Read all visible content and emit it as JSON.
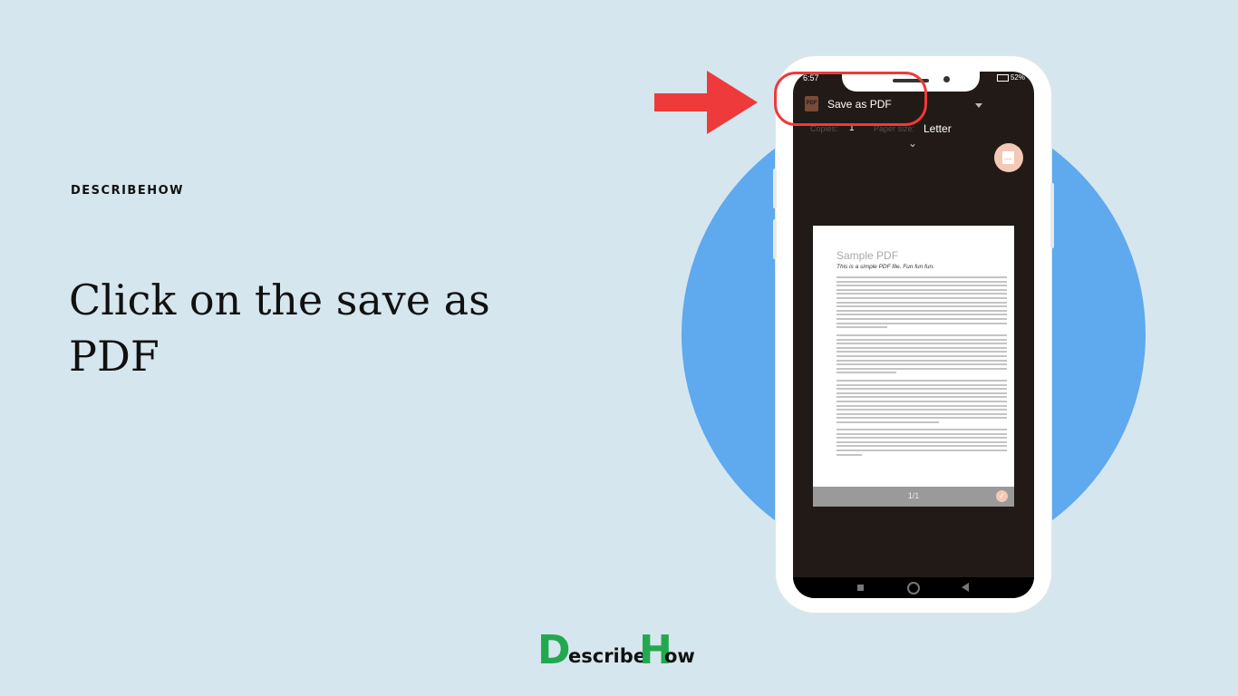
{
  "brand": {
    "label": "DESCRIBEHOW",
    "logo_first": "D",
    "logo_middle": "escribe",
    "logo_h": "H",
    "logo_end": "ow"
  },
  "headline": "Click on the save as PDF",
  "phone": {
    "status": {
      "time": "6:57",
      "battery": "52%"
    },
    "printer": {
      "title": "Save as PDF"
    },
    "options": {
      "copies_label": "Copies:",
      "copies_value": "1",
      "paper_size_label": "Paper size:",
      "paper_size_value": "Letter"
    },
    "fab_icon_text": "PDF",
    "document": {
      "title": "Sample PDF",
      "subtitle": "This is a simple PDF file. Fun fun fun."
    },
    "page_counter": "1/1"
  },
  "colors": {
    "background": "#d6e6ee",
    "circle": "#5fa9ee",
    "highlight": "#ee3a3a",
    "arrow": "#ee3a3a",
    "logo_green": "#22a94f"
  },
  "icons": {
    "printer_icon": "pdf-file-icon",
    "dropdown": "dropdown-triangle-icon",
    "expand": "chevron-down-icon",
    "fab": "save-pdf-icon",
    "check": "check-icon",
    "arrow": "arrow-right-icon"
  }
}
